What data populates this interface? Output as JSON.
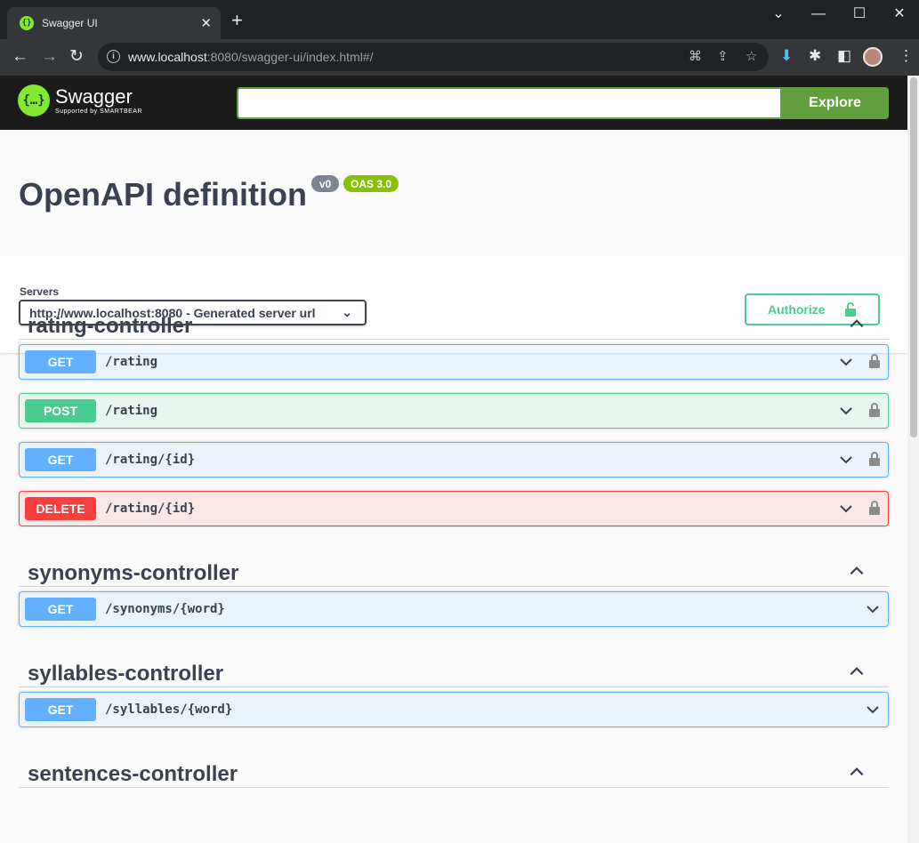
{
  "browser": {
    "tab_title": "Swagger UI",
    "url_host": "www.localhost",
    "url_path": ":8080/swagger-ui/index.html#/"
  },
  "swagger": {
    "brand": "Swagger",
    "brand_sub": "Supported by SMARTBEAR",
    "explore_label": "Explore",
    "url_input_value": ""
  },
  "info": {
    "title": "OpenAPI definition",
    "version_badge": "v0",
    "oas_badge": "OAS 3.0"
  },
  "servers": {
    "label": "Servers",
    "selected": "http://www.localhost:8080 - Generated server url"
  },
  "authorize_label": "Authorize",
  "colors": {
    "get": "#61affe",
    "post": "#49cc90",
    "delete": "#f93e3e",
    "swagger_green": "#85ea2d",
    "explore_green": "#62a03f"
  },
  "sections": [
    {
      "name": "rating-controller",
      "operations": [
        {
          "method": "GET",
          "path": "/rating",
          "locked": true
        },
        {
          "method": "POST",
          "path": "/rating",
          "locked": true
        },
        {
          "method": "GET",
          "path": "/rating/{id}",
          "locked": true
        },
        {
          "method": "DELETE",
          "path": "/rating/{id}",
          "locked": true
        }
      ]
    },
    {
      "name": "synonyms-controller",
      "operations": [
        {
          "method": "GET",
          "path": "/synonyms/{word}",
          "locked": false
        }
      ]
    },
    {
      "name": "syllables-controller",
      "operations": [
        {
          "method": "GET",
          "path": "/syllables/{word}",
          "locked": false
        }
      ]
    },
    {
      "name": "sentences-controller",
      "operations": []
    }
  ]
}
